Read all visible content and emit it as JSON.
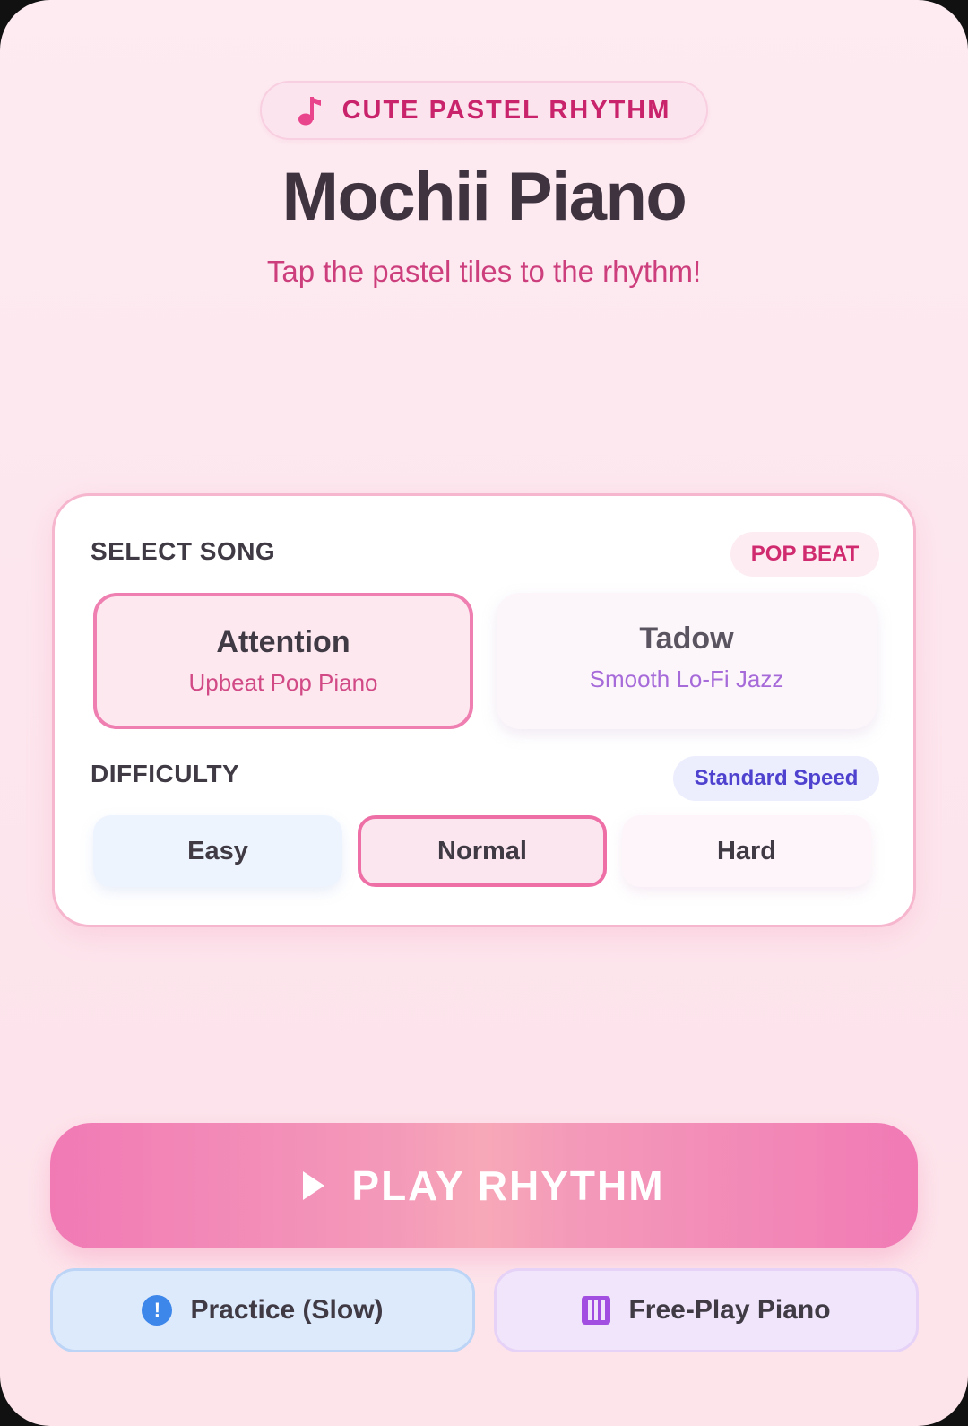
{
  "header": {
    "badge_label": "CUTE PASTEL RHYTHM",
    "badge_icon": "music-note-icon",
    "title": "Mochii Piano",
    "subtitle": "Tap the pastel tiles to the rhythm!"
  },
  "song_select": {
    "label": "SELECT SONG",
    "tag": "POP BEAT",
    "songs": [
      {
        "title": "Attention",
        "subtitle": "Upbeat Pop Piano",
        "selected": true
      },
      {
        "title": "Tadow",
        "subtitle": "Smooth Lo-Fi Jazz",
        "selected": false
      }
    ]
  },
  "difficulty": {
    "label": "DIFFICULTY",
    "tag": "Standard Speed",
    "options": [
      {
        "label": "Easy",
        "selected": false
      },
      {
        "label": "Normal",
        "selected": true
      },
      {
        "label": "Hard",
        "selected": false
      }
    ]
  },
  "actions": {
    "play_label": "PLAY RHYTHM",
    "practice_label": "Practice (Slow)",
    "free_play_label": "Free-Play Piano"
  },
  "colors": {
    "accent_pink": "#ee6fa6",
    "title_dark": "#3f3340",
    "subtitle_pink": "#cc3e7c",
    "speed_tag_blue": "#4f42cf",
    "practice_icon_blue": "#3d86ea",
    "free_play_icon_purple": "#a24ee0"
  }
}
